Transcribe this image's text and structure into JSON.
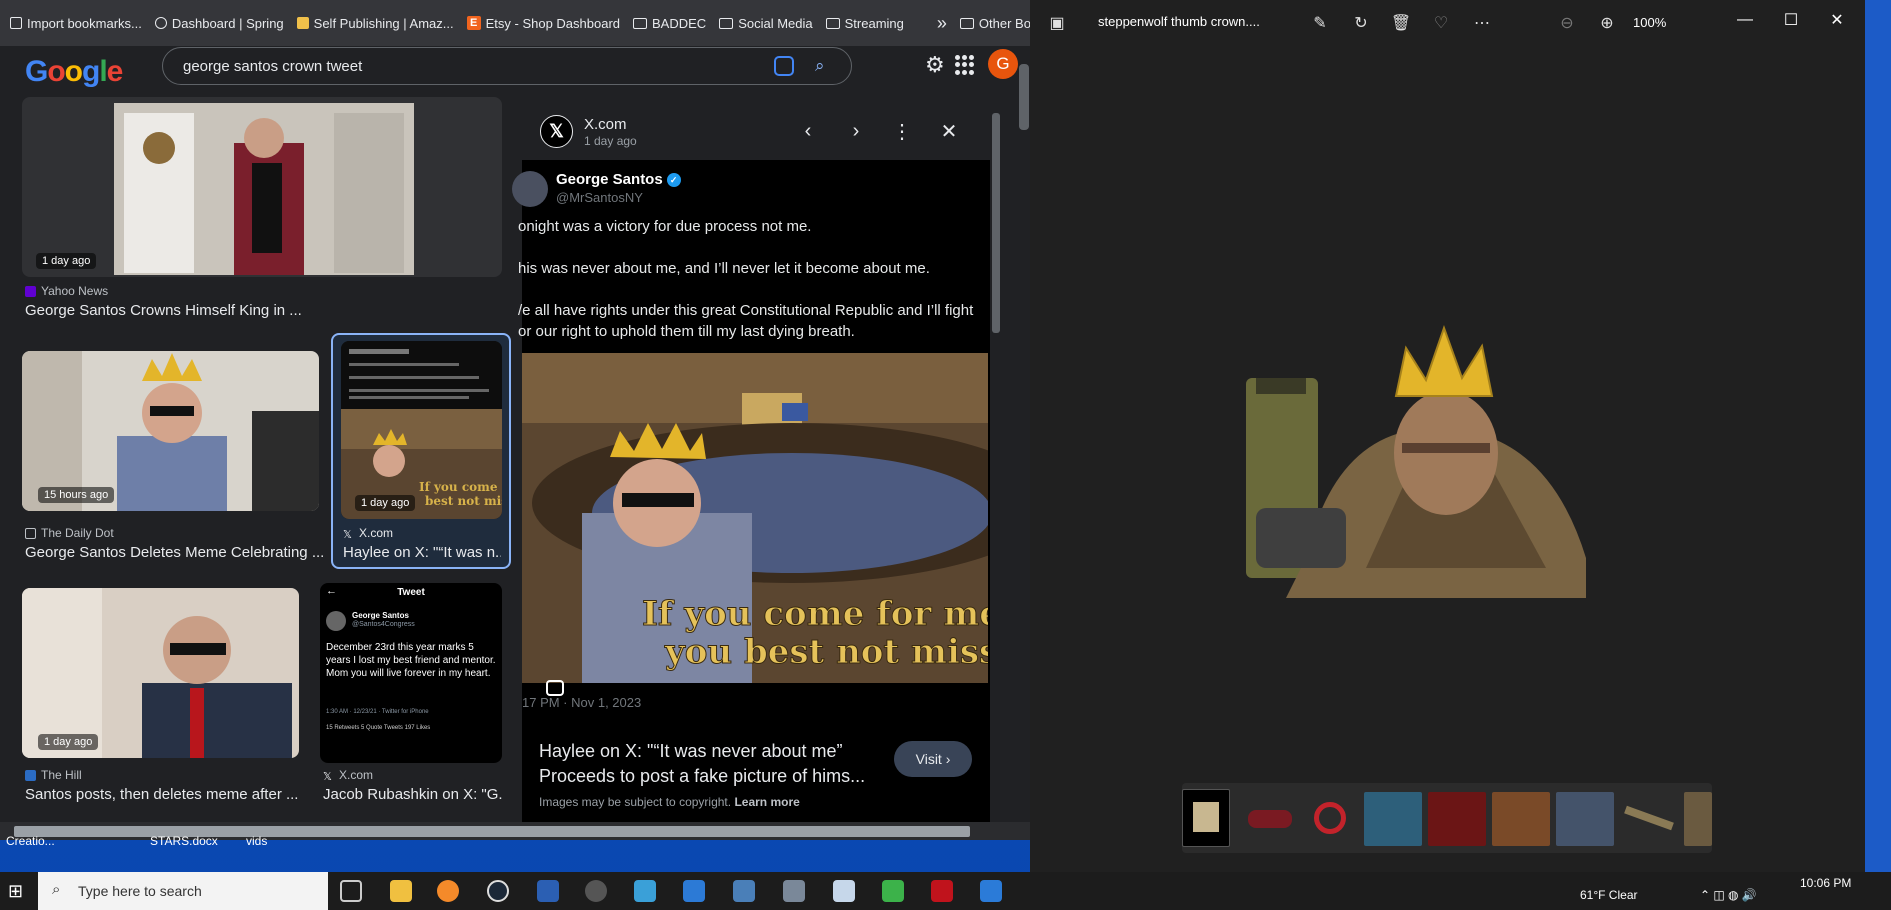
{
  "bookmarks": [
    {
      "label": "Import bookmarks..."
    },
    {
      "label": "Dashboard | Spring"
    },
    {
      "label": "Self Publishing | Amaz..."
    },
    {
      "label": "Etsy - Shop Dashboard"
    },
    {
      "label": "BADDEC"
    },
    {
      "label": "Social Media"
    },
    {
      "label": "Streaming"
    },
    {
      "label": "Other Bookmarks"
    }
  ],
  "overflow_label": "»",
  "search": {
    "value": "george santos crown tweet",
    "logo": "Google"
  },
  "avatar_letter": "G",
  "results": [
    {
      "ago": "1 day ago",
      "source": "Yahoo News",
      "title": "George Santos Crowns Himself King in ..."
    },
    {
      "ago": "15 hours ago",
      "source": "The Daily Dot",
      "title": "George Santos Deletes Meme Celebrating ..."
    },
    {
      "ago": "1 day ago",
      "source": "X.com",
      "title": "Haylee on X: \"“It was n..."
    },
    {
      "ago": "1 day ago",
      "source": "The Hill",
      "title": "Santos posts, then deletes meme after ..."
    },
    {
      "ago": "",
      "source": "X.com",
      "title": "Jacob Rubashkin on X: \"G..."
    }
  ],
  "tweet_card_small": {
    "header": "Tweet",
    "name": "George Santos",
    "handle": "@Santos4Congress",
    "body": "December 23rd this year marks 5 years I lost my best friend and mentor. Mom you will live forever in my heart.",
    "meta": "1:30 AM · 12/23/21 · Twitter for iPhone",
    "stats": "15 Retweets  5 Quote Tweets  197 Likes"
  },
  "panel": {
    "site": "X.com",
    "ago": "1 day ago",
    "user": "George Santos",
    "handle": "@MrSantosNY",
    "lines": [
      "onight was a victory for due process not me.",
      "his was never about me, and I’ll never let it become about me.",
      "/e all have rights under this great Constitutional Republic and I’ll fight",
      "or our right to uphold them till my last dying breath."
    ],
    "meme_line1": "If you come for me",
    "meme_line2": "you best not miss",
    "date": "17 PM · Nov 1, 2023",
    "visual_title": "Haylee on X: \"“It was never about me” Proceeds to post a fake picture of hims...",
    "visit": "Visit ›",
    "copyright": "Images may be subject to copyright.",
    "learn_more": "Learn more"
  },
  "desktop_labels": [
    "Creatio...",
    "STARS.docx",
    "vids"
  ],
  "viewer": {
    "title": "steppenwolf thumb crown....",
    "zoom": "100%"
  },
  "taskbar": {
    "search_placeholder": "Type here to search",
    "weather": "61°F  Clear",
    "time": "10:06 PM"
  },
  "colors": {
    "accent": "#8ab4f8",
    "avatar": "#e8550d",
    "crown": "#e3b52a"
  }
}
